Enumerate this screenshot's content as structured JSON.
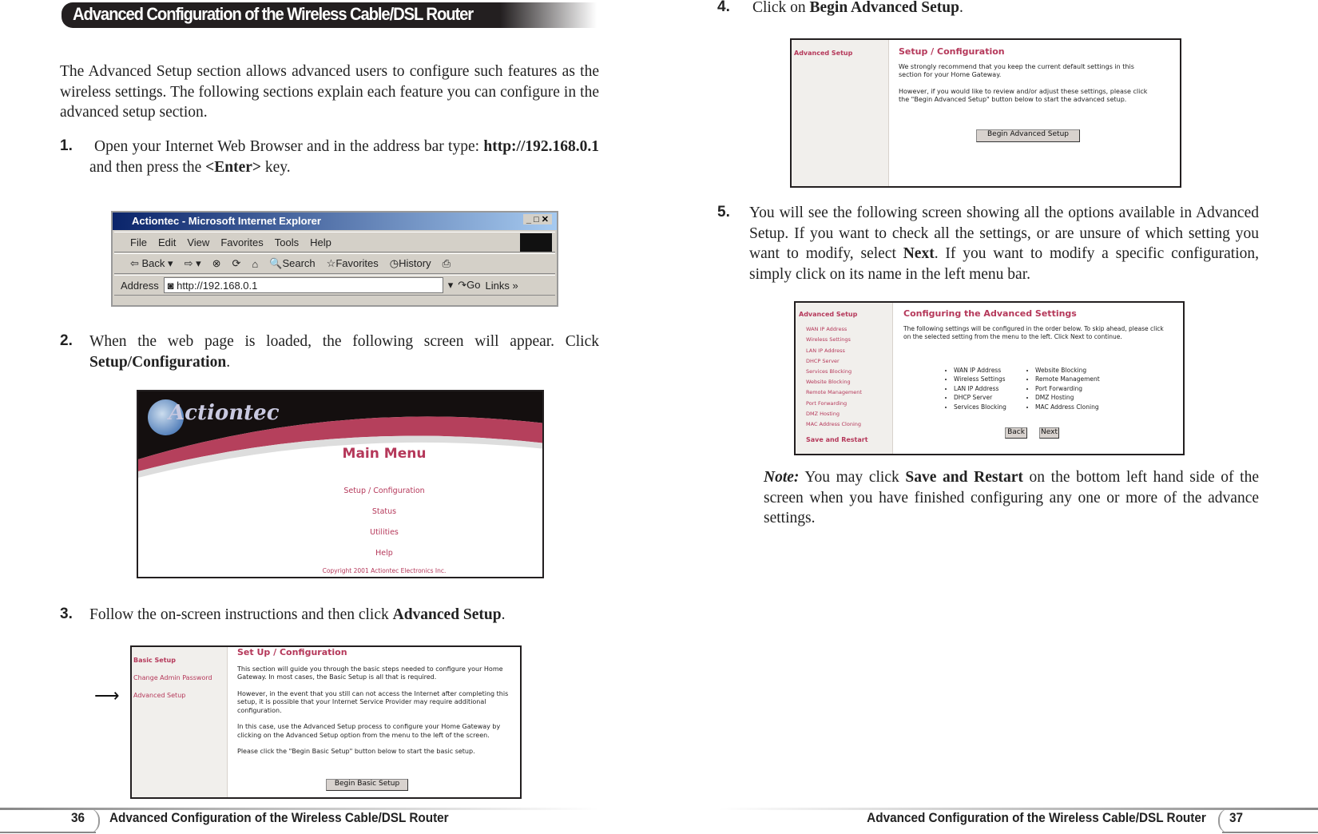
{
  "header": {
    "title": "Advanced Configuration of the Wireless Cable/DSL Router"
  },
  "intro": "The Advanced Setup section allows advanced users to configure such features as the wireless settings. The following sections explain each feature you can configure in the advanced setup section.",
  "steps": [
    {
      "num": "1.",
      "pre": "Open your Internet Web Browser and in the address bar type: ",
      "bold": "http://192.168.0.1",
      "post": " and then press the ",
      "bold2": "<Enter>",
      "post2": " key."
    },
    {
      "num": "2.",
      "pre": "When the web page is loaded, the following screen will appear. Click ",
      "bold": "Setup/Configuration",
      "post": "."
    },
    {
      "num": "3.",
      "pre": "Follow the on-screen instructions and then click ",
      "bold": "Advanced Setup",
      "post": "."
    },
    {
      "num": "4.",
      "pre": "Click on ",
      "bold": "Begin Advanced Setup",
      "post": "."
    },
    {
      "num": "5.",
      "pre": "You will see the following screen showing all the options available in Advanced Setup. If you want to check all the settings, or are unsure of which setting you want to modify, select ",
      "bold": "Next",
      "post": ". If you want to modify a specific configuration, simply click on its name in the left menu bar."
    }
  ],
  "note": {
    "label": "Note:",
    "pre": " You may click ",
    "bold": "Save and Restart",
    "post": " on the bottom left hand side of the screen when you have finished configuring any one or more of the advance settings."
  },
  "ie": {
    "title": "Actiontec - Microsoft Internet Explorer",
    "menu": [
      "File",
      "Edit",
      "View",
      "Favorites",
      "Tools",
      "Help"
    ],
    "toolbar": [
      "Back",
      "Search",
      "Favorites",
      "History"
    ],
    "address_label": "Address",
    "address": "http://192.168.0.1",
    "go": "Go",
    "links": "Links"
  },
  "main_menu": {
    "logo": "Actiontec",
    "title": "Main Menu",
    "links": [
      "Setup / Configuration",
      "Status",
      "Utilities",
      "Help"
    ],
    "copyright": "Copyright 2001 Actiontec Electronics Inc."
  },
  "setup_screen": {
    "side": [
      "Basic Setup",
      "Change Admin Password",
      "Advanced Setup"
    ],
    "title": "Set Up / Configuration",
    "paras": [
      "This section will guide you through the basic steps needed to configure your Home Gateway. In most cases, the Basic Setup is all that is required.",
      "However, in the event that you still can not access the Internet after completing this setup, it is possible that your Internet Service Provider may require additional configuration.",
      "In this case, use the Advanced Setup process to configure your Home Gateway by clicking on the Advanced Setup option from the menu to the left of the screen.",
      "Please click the \"Begin Basic Setup\" button below to start the basic setup."
    ],
    "button": "Begin Basic Setup"
  },
  "adv_screen": {
    "side": "Advanced Setup",
    "title": "Setup / Configuration",
    "paras": [
      "We strongly recommend that you keep the current default settings in this section for your Home Gateway.",
      "However, if you would like to review and/or adjust these settings, please click the \"Begin Advanced Setup\" button below to start the advanced setup."
    ],
    "button": "Begin Advanced Setup"
  },
  "cfg_screen": {
    "side_title": "Advanced Setup",
    "side": [
      "WAN IP Address",
      "Wireless Settings",
      "LAN IP Address",
      "DHCP Server",
      "Services Blocking",
      "Website Blocking",
      "Remote Management",
      "Port Forwarding",
      "DMZ Hosting",
      "MAC Address Cloning"
    ],
    "save": "Save and Restart",
    "title": "Configuring the Advanced Settings",
    "para": "The following settings will be configured in the order below. To skip ahead, please click on the selected setting from the menu to the left. Click Next to continue.",
    "col1": [
      "WAN IP Address",
      "Wireless Settings",
      "LAN IP Address",
      "DHCP Server",
      "Services Blocking"
    ],
    "col2": [
      "Website Blocking",
      "Remote Management",
      "Port Forwarding",
      "DMZ Hosting",
      "MAC Address Cloning"
    ],
    "back": "Back",
    "next": "Next"
  },
  "footer": {
    "left_page": "36",
    "right_page": "37",
    "title": "Advanced Configuration of the Wireless Cable/DSL Router"
  }
}
